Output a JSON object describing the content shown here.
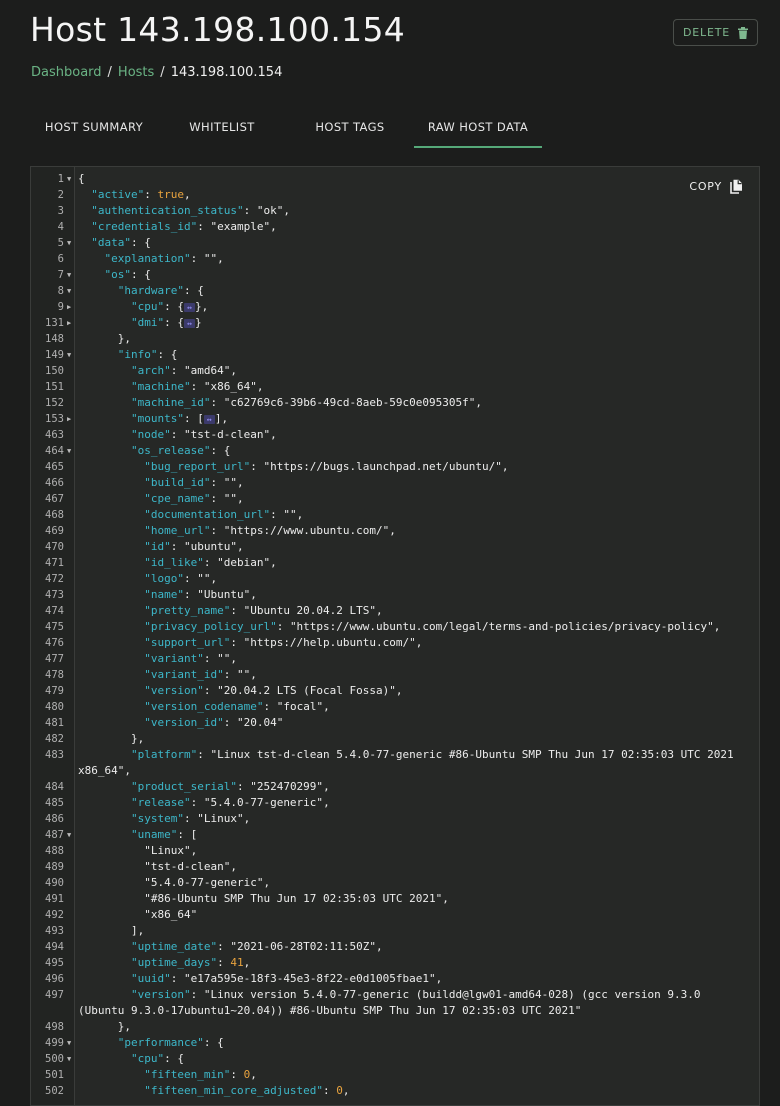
{
  "page": {
    "title": "Host 143.198.100.154",
    "delete_label": "DELETE",
    "copy_label": "COPY"
  },
  "breadcrumb": [
    {
      "label": "Dashboard"
    },
    {
      "label": "Hosts"
    },
    {
      "label": "143.198.100.154"
    }
  ],
  "breadcrumb_separator": "/",
  "tabs": [
    {
      "label": "HOST SUMMARY",
      "active": false
    },
    {
      "label": "WHITELIST",
      "active": false
    },
    {
      "label": "HOST TAGS",
      "active": false
    },
    {
      "label": "RAW HOST DATA",
      "active": true
    }
  ],
  "colors": {
    "accent": "#56a979",
    "json_key": "#3db7c9",
    "json_number": "#e8a33e",
    "collapsed_placeholder": "#3b3a6a"
  },
  "code_lines": [
    {
      "n": "1",
      "fold": "open",
      "t": [
        [
          "p",
          "{"
        ]
      ]
    },
    {
      "n": "2",
      "t": [
        [
          "i",
          1
        ],
        [
          "k",
          "\"active\""
        ],
        [
          "p",
          ": "
        ],
        [
          "b",
          "true"
        ],
        [
          "p",
          ","
        ]
      ]
    },
    {
      "n": "3",
      "t": [
        [
          "i",
          1
        ],
        [
          "k",
          "\"authentication_status\""
        ],
        [
          "p",
          ": "
        ],
        [
          "s",
          "\"ok\""
        ],
        [
          "p",
          ","
        ]
      ]
    },
    {
      "n": "4",
      "t": [
        [
          "i",
          1
        ],
        [
          "k",
          "\"credentials_id\""
        ],
        [
          "p",
          ": "
        ],
        [
          "s",
          "\"example\""
        ],
        [
          "p",
          ","
        ]
      ]
    },
    {
      "n": "5",
      "fold": "open",
      "t": [
        [
          "i",
          1
        ],
        [
          "k",
          "\"data\""
        ],
        [
          "p",
          ": {"
        ]
      ]
    },
    {
      "n": "6",
      "t": [
        [
          "i",
          2
        ],
        [
          "k",
          "\"explanation\""
        ],
        [
          "p",
          ": "
        ],
        [
          "s",
          "\"\""
        ],
        [
          "p",
          ","
        ]
      ]
    },
    {
      "n": "7",
      "fold": "open",
      "t": [
        [
          "i",
          2
        ],
        [
          "k",
          "\"os\""
        ],
        [
          "p",
          ": {"
        ]
      ]
    },
    {
      "n": "8",
      "fold": "open",
      "t": [
        [
          "i",
          3
        ],
        [
          "k",
          "\"hardware\""
        ],
        [
          "p",
          ": {"
        ]
      ]
    },
    {
      "n": "9",
      "fold": "closed",
      "t": [
        [
          "i",
          4
        ],
        [
          "k",
          "\"cpu\""
        ],
        [
          "p",
          ": {"
        ],
        [
          "ph",
          "↔"
        ],
        [
          "p",
          "},"
        ]
      ]
    },
    {
      "n": "131",
      "fold": "closed",
      "t": [
        [
          "i",
          4
        ],
        [
          "k",
          "\"dmi\""
        ],
        [
          "p",
          ": {"
        ],
        [
          "ph",
          "↔"
        ],
        [
          "p",
          "}"
        ]
      ]
    },
    {
      "n": "148",
      "t": [
        [
          "i",
          3
        ],
        [
          "p",
          "},"
        ]
      ]
    },
    {
      "n": "149",
      "fold": "open",
      "t": [
        [
          "i",
          3
        ],
        [
          "k",
          "\"info\""
        ],
        [
          "p",
          ": {"
        ]
      ]
    },
    {
      "n": "150",
      "t": [
        [
          "i",
          4
        ],
        [
          "k",
          "\"arch\""
        ],
        [
          "p",
          ": "
        ],
        [
          "s",
          "\"amd64\""
        ],
        [
          "p",
          ","
        ]
      ]
    },
    {
      "n": "151",
      "t": [
        [
          "i",
          4
        ],
        [
          "k",
          "\"machine\""
        ],
        [
          "p",
          ": "
        ],
        [
          "s",
          "\"x86_64\""
        ],
        [
          "p",
          ","
        ]
      ]
    },
    {
      "n": "152",
      "t": [
        [
          "i",
          4
        ],
        [
          "k",
          "\"machine_id\""
        ],
        [
          "p",
          ": "
        ],
        [
          "s",
          "\"c62769c6-39b6-49cd-8aeb-59c0e095305f\""
        ],
        [
          "p",
          ","
        ]
      ]
    },
    {
      "n": "153",
      "fold": "closed",
      "t": [
        [
          "i",
          4
        ],
        [
          "k",
          "\"mounts\""
        ],
        [
          "p",
          ": ["
        ],
        [
          "ph",
          "↔"
        ],
        [
          "p",
          "],"
        ]
      ]
    },
    {
      "n": "463",
      "t": [
        [
          "i",
          4
        ],
        [
          "k",
          "\"node\""
        ],
        [
          "p",
          ": "
        ],
        [
          "s",
          "\"tst-d-clean\""
        ],
        [
          "p",
          ","
        ]
      ]
    },
    {
      "n": "464",
      "fold": "open",
      "t": [
        [
          "i",
          4
        ],
        [
          "k",
          "\"os_release\""
        ],
        [
          "p",
          ": {"
        ]
      ]
    },
    {
      "n": "465",
      "t": [
        [
          "i",
          5
        ],
        [
          "k",
          "\"bug_report_url\""
        ],
        [
          "p",
          ": "
        ],
        [
          "s",
          "\"https://bugs.launchpad.net/ubuntu/\""
        ],
        [
          "p",
          ","
        ]
      ]
    },
    {
      "n": "466",
      "t": [
        [
          "i",
          5
        ],
        [
          "k",
          "\"build_id\""
        ],
        [
          "p",
          ": "
        ],
        [
          "s",
          "\"\""
        ],
        [
          "p",
          ","
        ]
      ]
    },
    {
      "n": "467",
      "t": [
        [
          "i",
          5
        ],
        [
          "k",
          "\"cpe_name\""
        ],
        [
          "p",
          ": "
        ],
        [
          "s",
          "\"\""
        ],
        [
          "p",
          ","
        ]
      ]
    },
    {
      "n": "468",
      "t": [
        [
          "i",
          5
        ],
        [
          "k",
          "\"documentation_url\""
        ],
        [
          "p",
          ": "
        ],
        [
          "s",
          "\"\""
        ],
        [
          "p",
          ","
        ]
      ]
    },
    {
      "n": "469",
      "t": [
        [
          "i",
          5
        ],
        [
          "k",
          "\"home_url\""
        ],
        [
          "p",
          ": "
        ],
        [
          "s",
          "\"https://www.ubuntu.com/\""
        ],
        [
          "p",
          ","
        ]
      ]
    },
    {
      "n": "470",
      "t": [
        [
          "i",
          5
        ],
        [
          "k",
          "\"id\""
        ],
        [
          "p",
          ": "
        ],
        [
          "s",
          "\"ubuntu\""
        ],
        [
          "p",
          ","
        ]
      ]
    },
    {
      "n": "471",
      "t": [
        [
          "i",
          5
        ],
        [
          "k",
          "\"id_like\""
        ],
        [
          "p",
          ": "
        ],
        [
          "s",
          "\"debian\""
        ],
        [
          "p",
          ","
        ]
      ]
    },
    {
      "n": "472",
      "t": [
        [
          "i",
          5
        ],
        [
          "k",
          "\"logo\""
        ],
        [
          "p",
          ": "
        ],
        [
          "s",
          "\"\""
        ],
        [
          "p",
          ","
        ]
      ]
    },
    {
      "n": "473",
      "t": [
        [
          "i",
          5
        ],
        [
          "k",
          "\"name\""
        ],
        [
          "p",
          ": "
        ],
        [
          "s",
          "\"Ubuntu\""
        ],
        [
          "p",
          ","
        ]
      ]
    },
    {
      "n": "474",
      "t": [
        [
          "i",
          5
        ],
        [
          "k",
          "\"pretty_name\""
        ],
        [
          "p",
          ": "
        ],
        [
          "s",
          "\"Ubuntu 20.04.2 LTS\""
        ],
        [
          "p",
          ","
        ]
      ]
    },
    {
      "n": "475",
      "t": [
        [
          "i",
          5
        ],
        [
          "k",
          "\"privacy_policy_url\""
        ],
        [
          "p",
          ": "
        ],
        [
          "s",
          "\"https://www.ubuntu.com/legal/terms-and-policies/privacy-policy\""
        ],
        [
          "p",
          ","
        ]
      ]
    },
    {
      "n": "476",
      "t": [
        [
          "i",
          5
        ],
        [
          "k",
          "\"support_url\""
        ],
        [
          "p",
          ": "
        ],
        [
          "s",
          "\"https://help.ubuntu.com/\""
        ],
        [
          "p",
          ","
        ]
      ]
    },
    {
      "n": "477",
      "t": [
        [
          "i",
          5
        ],
        [
          "k",
          "\"variant\""
        ],
        [
          "p",
          ": "
        ],
        [
          "s",
          "\"\""
        ],
        [
          "p",
          ","
        ]
      ]
    },
    {
      "n": "478",
      "t": [
        [
          "i",
          5
        ],
        [
          "k",
          "\"variant_id\""
        ],
        [
          "p",
          ": "
        ],
        [
          "s",
          "\"\""
        ],
        [
          "p",
          ","
        ]
      ]
    },
    {
      "n": "479",
      "t": [
        [
          "i",
          5
        ],
        [
          "k",
          "\"version\""
        ],
        [
          "p",
          ": "
        ],
        [
          "s",
          "\"20.04.2 LTS (Focal Fossa)\""
        ],
        [
          "p",
          ","
        ]
      ]
    },
    {
      "n": "480",
      "t": [
        [
          "i",
          5
        ],
        [
          "k",
          "\"version_codename\""
        ],
        [
          "p",
          ": "
        ],
        [
          "s",
          "\"focal\""
        ],
        [
          "p",
          ","
        ]
      ]
    },
    {
      "n": "481",
      "t": [
        [
          "i",
          5
        ],
        [
          "k",
          "\"version_id\""
        ],
        [
          "p",
          ": "
        ],
        [
          "s",
          "\"20.04\""
        ]
      ]
    },
    {
      "n": "482",
      "t": [
        [
          "i",
          4
        ],
        [
          "p",
          "},"
        ]
      ]
    },
    {
      "n": "483",
      "wrap": true,
      "t": [
        [
          "i",
          4
        ],
        [
          "k",
          "\"platform\""
        ],
        [
          "p",
          ": "
        ],
        [
          "s",
          "\"Linux tst-d-clean 5.4.0-77-generic #86-Ubuntu SMP Thu Jun 17 02:35:03 UTC 2021 x86_64\""
        ],
        [
          "p",
          ","
        ]
      ]
    },
    {
      "n": "484",
      "t": [
        [
          "i",
          4
        ],
        [
          "k",
          "\"product_serial\""
        ],
        [
          "p",
          ": "
        ],
        [
          "s",
          "\"252470299\""
        ],
        [
          "p",
          ","
        ]
      ]
    },
    {
      "n": "485",
      "t": [
        [
          "i",
          4
        ],
        [
          "k",
          "\"release\""
        ],
        [
          "p",
          ": "
        ],
        [
          "s",
          "\"5.4.0-77-generic\""
        ],
        [
          "p",
          ","
        ]
      ]
    },
    {
      "n": "486",
      "t": [
        [
          "i",
          4
        ],
        [
          "k",
          "\"system\""
        ],
        [
          "p",
          ": "
        ],
        [
          "s",
          "\"Linux\""
        ],
        [
          "p",
          ","
        ]
      ]
    },
    {
      "n": "487",
      "fold": "open",
      "t": [
        [
          "i",
          4
        ],
        [
          "k",
          "\"uname\""
        ],
        [
          "p",
          ": ["
        ]
      ]
    },
    {
      "n": "488",
      "t": [
        [
          "i",
          5
        ],
        [
          "s",
          "\"Linux\""
        ],
        [
          "p",
          ","
        ]
      ]
    },
    {
      "n": "489",
      "t": [
        [
          "i",
          5
        ],
        [
          "s",
          "\"tst-d-clean\""
        ],
        [
          "p",
          ","
        ]
      ]
    },
    {
      "n": "490",
      "t": [
        [
          "i",
          5
        ],
        [
          "s",
          "\"5.4.0-77-generic\""
        ],
        [
          "p",
          ","
        ]
      ]
    },
    {
      "n": "491",
      "t": [
        [
          "i",
          5
        ],
        [
          "s",
          "\"#86-Ubuntu SMP Thu Jun 17 02:35:03 UTC 2021\""
        ],
        [
          "p",
          ","
        ]
      ]
    },
    {
      "n": "492",
      "t": [
        [
          "i",
          5
        ],
        [
          "s",
          "\"x86_64\""
        ]
      ]
    },
    {
      "n": "493",
      "t": [
        [
          "i",
          4
        ],
        [
          "p",
          "],"
        ]
      ]
    },
    {
      "n": "494",
      "t": [
        [
          "i",
          4
        ],
        [
          "k",
          "\"uptime_date\""
        ],
        [
          "p",
          ": "
        ],
        [
          "s",
          "\"2021-06-28T02:11:50Z\""
        ],
        [
          "p",
          ","
        ]
      ]
    },
    {
      "n": "495",
      "t": [
        [
          "i",
          4
        ],
        [
          "k",
          "\"uptime_days\""
        ],
        [
          "p",
          ": "
        ],
        [
          "n",
          "41"
        ],
        [
          "p",
          ","
        ]
      ]
    },
    {
      "n": "496",
      "t": [
        [
          "i",
          4
        ],
        [
          "k",
          "\"uuid\""
        ],
        [
          "p",
          ": "
        ],
        [
          "s",
          "\"e17a595e-18f3-45e3-8f22-e0d1005fbae1\""
        ],
        [
          "p",
          ","
        ]
      ]
    },
    {
      "n": "497",
      "wrap": true,
      "t": [
        [
          "i",
          4
        ],
        [
          "k",
          "\"version\""
        ],
        [
          "p",
          ": "
        ],
        [
          "s",
          "\"Linux version 5.4.0-77-generic (buildd@lgw01-amd64-028) (gcc version 9.3.0 (Ubuntu 9.3.0-17ubuntu1~20.04)) #86-Ubuntu SMP Thu Jun 17 02:35:03 UTC 2021\""
        ]
      ]
    },
    {
      "n": "498",
      "t": [
        [
          "i",
          3
        ],
        [
          "p",
          "},"
        ]
      ]
    },
    {
      "n": "499",
      "fold": "open",
      "t": [
        [
          "i",
          3
        ],
        [
          "k",
          "\"performance\""
        ],
        [
          "p",
          ": {"
        ]
      ]
    },
    {
      "n": "500",
      "fold": "open",
      "t": [
        [
          "i",
          4
        ],
        [
          "k",
          "\"cpu\""
        ],
        [
          "p",
          ": {"
        ]
      ]
    },
    {
      "n": "501",
      "t": [
        [
          "i",
          5
        ],
        [
          "k",
          "\"fifteen_min\""
        ],
        [
          "p",
          ": "
        ],
        [
          "n",
          "0"
        ],
        [
          "p",
          ","
        ]
      ]
    },
    {
      "n": "502",
      "t": [
        [
          "i",
          5
        ],
        [
          "k",
          "\"fifteen_min_core_adjusted\""
        ],
        [
          "p",
          ": "
        ],
        [
          "n",
          "0"
        ],
        [
          "p",
          ","
        ]
      ]
    }
  ]
}
